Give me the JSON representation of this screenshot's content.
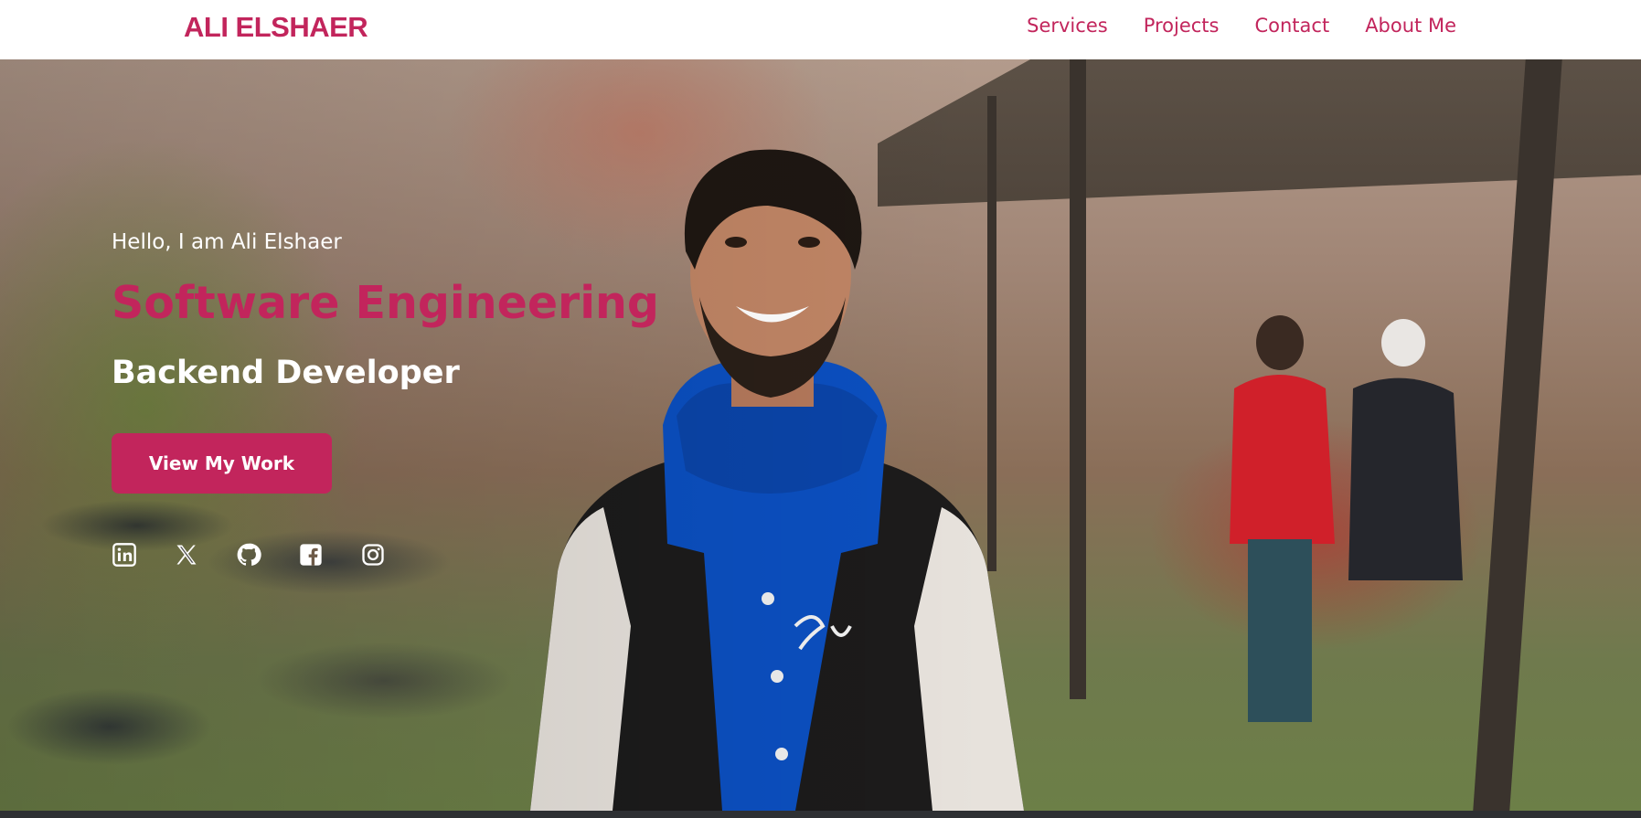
{
  "nav": {
    "brand": "ALI ELSHAER",
    "links": [
      "Services",
      "Projects",
      "Contact",
      "About Me"
    ]
  },
  "hero": {
    "greeting": "Hello, I am Ali Elshaer",
    "headline": "Software Engineering",
    "subheadline": "Backend Developer",
    "cta_label": "View My Work",
    "socials": [
      "linkedin-icon",
      "x-icon",
      "github-icon",
      "facebook-icon",
      "instagram-icon"
    ]
  },
  "colors": {
    "accent": "#c2255c",
    "text_on_image": "#ffffff",
    "nav_background": "#ffffff"
  }
}
